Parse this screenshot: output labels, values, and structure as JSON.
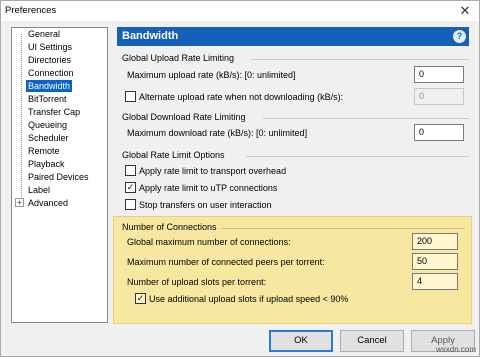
{
  "window": {
    "title": "Preferences",
    "close_glyph": "✕"
  },
  "tree": {
    "items": [
      {
        "label": "General"
      },
      {
        "label": "UI Settings"
      },
      {
        "label": "Directories"
      },
      {
        "label": "Connection"
      },
      {
        "label": "Bandwidth",
        "selected": true
      },
      {
        "label": "BitTorrent"
      },
      {
        "label": "Transfer Cap"
      },
      {
        "label": "Queueing"
      },
      {
        "label": "Scheduler"
      },
      {
        "label": "Remote"
      },
      {
        "label": "Playback"
      },
      {
        "label": "Paired Devices"
      },
      {
        "label": "Label"
      },
      {
        "label": "Advanced",
        "expandable": true
      }
    ],
    "expander_glyph": "+"
  },
  "header": {
    "title": "Bandwidth",
    "help_glyph": "?"
  },
  "upload": {
    "title": "Global Upload Rate Limiting",
    "max_label": "Maximum upload rate (kB/s): [0: unlimited]",
    "max_value": "0",
    "alt_label": "Alternate upload rate when not downloading (kB/s):",
    "alt_checked": false,
    "alt_value": "0"
  },
  "download": {
    "title": "Global Download Rate Limiting",
    "max_label": "Maximum download rate (kB/s): [0: unlimited]",
    "max_value": "0"
  },
  "options": {
    "title": "Global Rate Limit Options",
    "items": [
      {
        "label": "Apply rate limit to transport overhead",
        "checked": false
      },
      {
        "label": "Apply rate limit to uTP connections",
        "checked": true
      },
      {
        "label": "Stop transfers on user interaction",
        "checked": false
      }
    ]
  },
  "connections": {
    "title": "Number of Connections",
    "global_label": "Global maximum number of connections:",
    "global_value": "200",
    "peers_label": "Maximum number of connected peers per torrent:",
    "peers_value": "50",
    "slots_label": "Number of upload slots per torrent:",
    "slots_value": "4",
    "additional_label": "Use additional upload slots if upload speed < 90%",
    "additional_checked": true
  },
  "buttons": {
    "ok": "OK",
    "cancel": "Cancel",
    "apply": "Apply"
  },
  "check_glyph": "✓",
  "watermark": "wsxdn.com"
}
